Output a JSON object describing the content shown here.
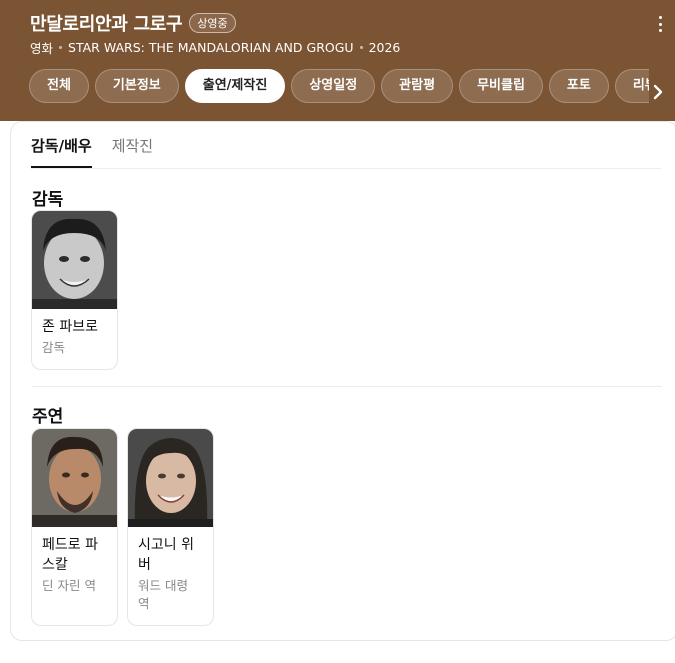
{
  "header": {
    "title": "만달로리안과 그로구",
    "badge": "상영중",
    "meta": [
      "영화",
      "STAR WARS: THE MANDALORIAN AND GROGU",
      "2026"
    ]
  },
  "tabs": [
    {
      "label": "전체",
      "active": false
    },
    {
      "label": "기본정보",
      "active": false
    },
    {
      "label": "출연/제작진",
      "active": true
    },
    {
      "label": "상영일정",
      "active": false
    },
    {
      "label": "관람평",
      "active": false
    },
    {
      "label": "무비클립",
      "active": false
    },
    {
      "label": "포토",
      "active": false
    },
    {
      "label": "리뷰",
      "active": false
    }
  ],
  "subtabs": [
    {
      "label": "감독/배우",
      "active": true
    },
    {
      "label": "제작진",
      "active": false
    }
  ],
  "sections": {
    "director": {
      "title": "감독",
      "people": [
        {
          "name": "존 파브로",
          "role": "감독"
        }
      ]
    },
    "cast": {
      "title": "주연",
      "people": [
        {
          "name": "페드로 파스칼",
          "role": "딘 자린 역"
        },
        {
          "name": "시고니 위버",
          "role": "워드 대령 역"
        }
      ]
    }
  },
  "colors": {
    "header_bg": "#7b5433",
    "active_tab_bg": "#ffffff"
  }
}
